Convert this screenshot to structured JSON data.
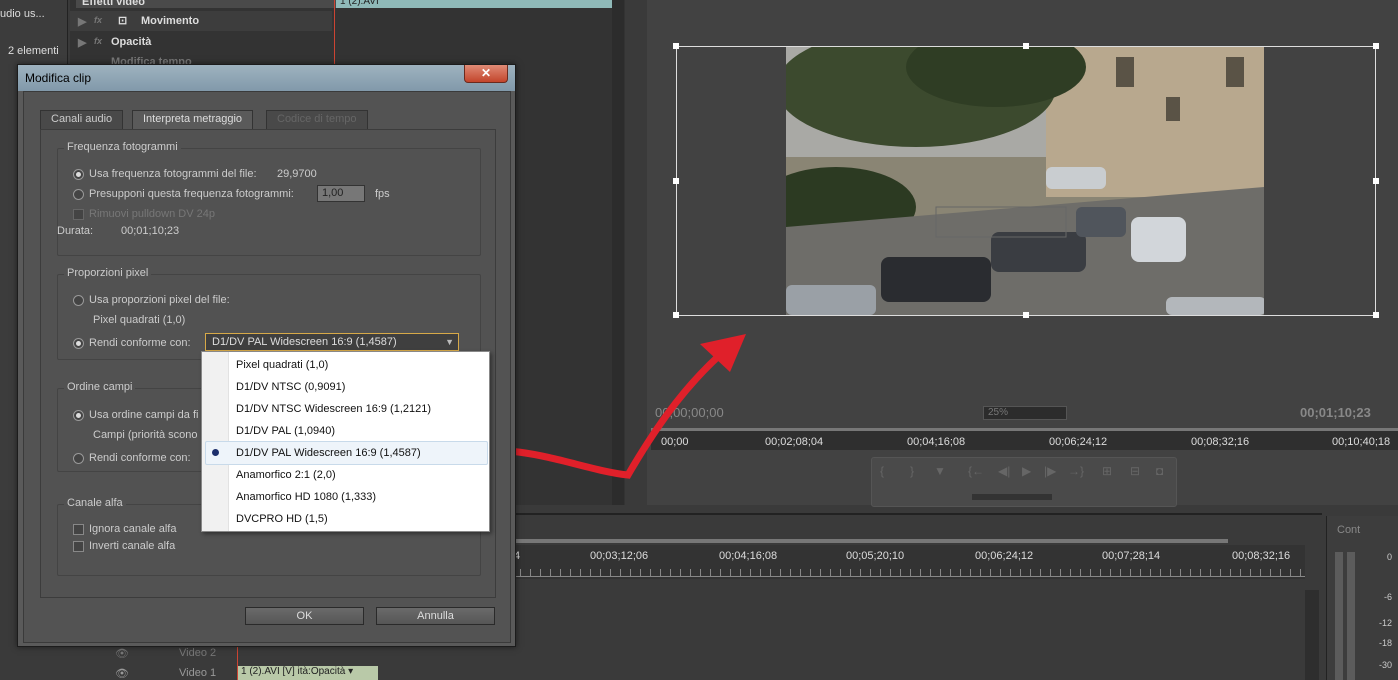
{
  "project": {
    "label_top": "udio us...",
    "count": "2 elementi"
  },
  "effects": {
    "header": "Effetti video",
    "clip_label": "1 (2).AVI",
    "rows": [
      {
        "label": "Movimento"
      },
      {
        "label": "Opacità"
      },
      {
        "label": "Modifica tempo"
      }
    ]
  },
  "monitor": {
    "timecode_current": "00;00;00;00",
    "timecode_duration": "00;01;10;23",
    "zoom": "25%",
    "ruler": [
      "00;00",
      "00;02;08;04",
      "00;04;16;08",
      "00;06;24;12",
      "00;08;32;16",
      "00;10;40;18"
    ]
  },
  "sequence": {
    "ruler": [
      "4",
      "00;03;12;06",
      "00;04;16;08",
      "00;05;20;10",
      "00;06;24;12",
      "00;07;28;14",
      "00;08;32;16"
    ],
    "track_video2": "Video 2",
    "track_video1": "Video 1",
    "clip_v1": "1 (2).AVI [V]  ità:Opacità ▾"
  },
  "audio_meter": {
    "title": "Cont",
    "levels": [
      "0",
      "-6",
      "-12",
      "-18",
      "-30"
    ]
  },
  "dialog": {
    "title": "Modifica clip",
    "close": "✕",
    "tabs": [
      {
        "label": "Canali audio",
        "state": "normal"
      },
      {
        "label": "Interpreta metraggio",
        "state": "active"
      },
      {
        "label": "Codice di tempo",
        "state": "disabled"
      }
    ],
    "frame_rate": {
      "title": "Frequenza fotogrammi",
      "use_file": "Usa frequenza fotogrammi del file:",
      "file_value": "29,9700",
      "assume": "Presupponi questa frequenza fotogrammi:",
      "assume_value": "1,00",
      "unit": "fps",
      "pulldown": "Rimuovi pulldown DV 24p",
      "duration_label": "Durata:",
      "duration_value": "00;01;10;23"
    },
    "pixel_aspect": {
      "title": "Proporzioni pixel",
      "use_file": "Usa proporzioni pixel del file:",
      "file_value": "Pixel quadrati (1,0)",
      "conform": "Rendi conforme con:",
      "selected": "D1/DV PAL Widescreen 16:9 (1,4587)"
    },
    "field_order": {
      "title": "Ordine campi",
      "use_file": "Usa ordine campi da fi",
      "file_value": "Campi (priorità scono",
      "conform": "Rendi conforme con:"
    },
    "alpha": {
      "title": "Canale alfa",
      "ignore": "Ignora canale alfa",
      "invert": "Inverti canale alfa"
    },
    "ok": "OK",
    "cancel": "Annulla"
  },
  "dropdown": {
    "options": [
      "Pixel quadrati (1,0)",
      "D1/DV NTSC (0,9091)",
      "D1/DV NTSC Widescreen 16:9 (1,2121)",
      "D1/DV PAL (1,0940)",
      "D1/DV PAL Widescreen 16:9 (1,4587)",
      "Anamorfico 2:1 (2,0)",
      "Anamorfico HD 1080 (1,333)",
      "DVCPRO HD (1,5)"
    ],
    "selected_index": 4
  },
  "colors": {
    "accent_arrow": "#e0202a",
    "dialog_title": "#8fa6b5",
    "select_border": "#d7a948"
  }
}
